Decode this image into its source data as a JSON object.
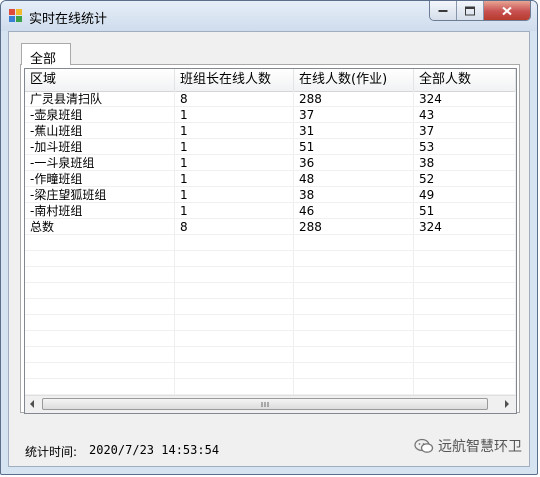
{
  "window": {
    "title": "实时在线统计"
  },
  "tabs": [
    {
      "label": "全部"
    }
  ],
  "grid": {
    "columns": [
      "区域",
      "班组长在线人数",
      "在线人数(作业)",
      "全部人数"
    ],
    "rows": [
      [
        "广灵县清扫队",
        "8",
        "288",
        "324"
      ],
      [
        "-壶泉班组",
        "1",
        "37",
        "43"
      ],
      [
        "-蕉山班组",
        "1",
        "31",
        "37"
      ],
      [
        "-加斗班组",
        "1",
        "51",
        "53"
      ],
      [
        "-一斗泉班组",
        "1",
        "36",
        "38"
      ],
      [
        "-作疃班组",
        "1",
        "48",
        "52"
      ],
      [
        "-梁庄望狐班组",
        "1",
        "38",
        "49"
      ],
      [
        "-南村班组",
        "1",
        "46",
        "51"
      ],
      [
        "总数",
        "8",
        "288",
        "324"
      ]
    ]
  },
  "footer": {
    "stat_label": "统计时间:",
    "stat_time": "2020/7/23 14:53:54"
  },
  "watermark": {
    "text": "远航智慧环卫"
  },
  "icons": {
    "app": "app-icon",
    "minimize": "minimize-icon",
    "maximize": "maximize-icon",
    "close": "close-icon",
    "scroll_left": "chevron-left-icon",
    "scroll_right": "chevron-right-icon",
    "watermark": "wechat-icon"
  },
  "colors": {
    "close_button": "#c75050",
    "title_bar": "#d6e3f1"
  }
}
